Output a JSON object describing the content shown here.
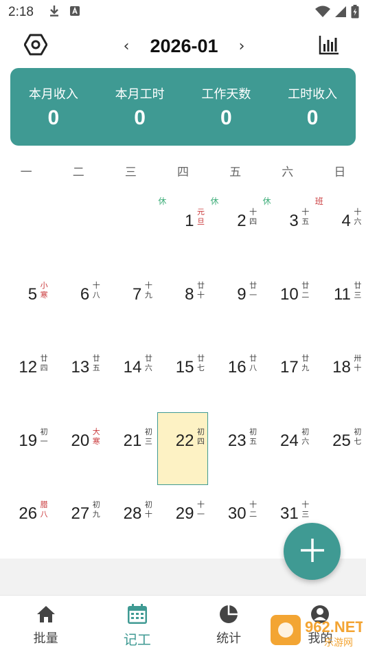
{
  "status_bar": {
    "time": "2:18"
  },
  "header": {
    "month": "2026-01",
    "prev_arrow": "‹",
    "next_arrow": "›"
  },
  "summary": [
    {
      "label": "本月收入",
      "value": "0"
    },
    {
      "label": "本月工时",
      "value": "0"
    },
    {
      "label": "工作天数",
      "value": "0"
    },
    {
      "label": "工时收入",
      "value": "0"
    }
  ],
  "weekdays": [
    "一",
    "二",
    "三",
    "四",
    "五",
    "六",
    "日"
  ],
  "calendar": {
    "today": 22,
    "weeks": [
      [
        null,
        null,
        null,
        {
          "day": "1",
          "lunar": "元旦",
          "red": true,
          "tag": "休",
          "tag_type": "rest"
        },
        {
          "day": "2",
          "lunar": "十四",
          "red": false,
          "tag": "休",
          "tag_type": "rest"
        },
        {
          "day": "3",
          "lunar": "十五",
          "red": false,
          "tag": "休",
          "tag_type": "rest"
        },
        {
          "day": "4",
          "lunar": "十六",
          "red": false,
          "tag": "班",
          "tag_type": "work"
        }
      ],
      [
        {
          "day": "5",
          "lunar": "小寒",
          "red": true
        },
        {
          "day": "6",
          "lunar": "十八",
          "red": false
        },
        {
          "day": "7",
          "lunar": "十九",
          "red": false
        },
        {
          "day": "8",
          "lunar": "廿十",
          "red": false
        },
        {
          "day": "9",
          "lunar": "廿一",
          "red": false
        },
        {
          "day": "10",
          "lunar": "廿二",
          "red": false
        },
        {
          "day": "11",
          "lunar": "廿三",
          "red": false
        }
      ],
      [
        {
          "day": "12",
          "lunar": "廿四",
          "red": false
        },
        {
          "day": "13",
          "lunar": "廿五",
          "red": false
        },
        {
          "day": "14",
          "lunar": "廿六",
          "red": false
        },
        {
          "day": "15",
          "lunar": "廿七",
          "red": false
        },
        {
          "day": "16",
          "lunar": "廿八",
          "red": false
        },
        {
          "day": "17",
          "lunar": "廿九",
          "red": false
        },
        {
          "day": "18",
          "lunar": "卅十",
          "red": false
        }
      ],
      [
        {
          "day": "19",
          "lunar": "初一",
          "red": false
        },
        {
          "day": "20",
          "lunar": "大寒",
          "red": true
        },
        {
          "day": "21",
          "lunar": "初三",
          "red": false
        },
        {
          "day": "22",
          "lunar": "初四",
          "red": false,
          "today": true
        },
        {
          "day": "23",
          "lunar": "初五",
          "red": false
        },
        {
          "day": "24",
          "lunar": "初六",
          "red": false
        },
        {
          "day": "25",
          "lunar": "初七",
          "red": false
        }
      ],
      [
        {
          "day": "26",
          "lunar": "腊八",
          "red": true
        },
        {
          "day": "27",
          "lunar": "初九",
          "red": false
        },
        {
          "day": "28",
          "lunar": "初十",
          "red": false
        },
        {
          "day": "29",
          "lunar": "十一",
          "red": false
        },
        {
          "day": "30",
          "lunar": "十二",
          "red": false
        },
        {
          "day": "31",
          "lunar": "十三",
          "red": false
        },
        null
      ]
    ]
  },
  "bottom_nav": [
    {
      "label": "批量",
      "icon": "home-icon"
    },
    {
      "label": "记工",
      "icon": "calendar-icon",
      "active": true
    },
    {
      "label": "统计",
      "icon": "pie-chart-icon"
    },
    {
      "label": "我的",
      "icon": "person-icon"
    }
  ],
  "watermark": {
    "text_top": "962.NET",
    "text_bottom": "乐游网"
  },
  "colors": {
    "accent": "#3f9a93",
    "today_fill": "#fdf2c4",
    "rest_tag": "#3fae7a",
    "work_tag": "#c9383a",
    "festival_red": "#c9383a"
  }
}
